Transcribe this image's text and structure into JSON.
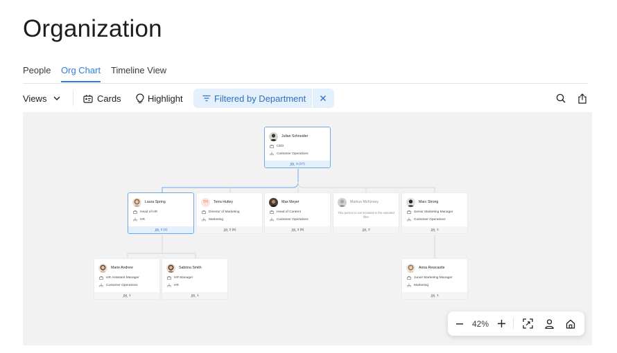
{
  "page": {
    "title": "Organization"
  },
  "tabs": [
    {
      "label": "People",
      "active": false
    },
    {
      "label": "Org Chart",
      "active": true
    },
    {
      "label": "Timeline View",
      "active": false
    }
  ],
  "toolbar": {
    "views_label": "Views",
    "cards_label": "Cards",
    "highlight_label": "Highlight",
    "filter_label": "Filtered by Department"
  },
  "nodes": {
    "julian": {
      "name": "Julian Schneider",
      "title": "CEO",
      "department": "Customer Operations",
      "reports": "5 (27)"
    },
    "laura": {
      "name": "Laura Spring",
      "title": "Head of HR",
      "department": "HR",
      "reports": "2 (4)"
    },
    "terra": {
      "name": "Terra Hutley",
      "initials": "TH",
      "title": "Director of Marketing",
      "department": "Marketing",
      "reports": "2 (6)"
    },
    "max": {
      "name": "Max Meyer",
      "title": "Head of Content",
      "department": "Customer Operations",
      "reports": "3 (9)"
    },
    "markus": {
      "name": "Markus McKinsey",
      "note": "This person is not included in the selected filter",
      "reports": "2"
    },
    "marc": {
      "name": "Marc Strong",
      "title": "Senior Marketing Manager",
      "department": "Customer Operations",
      "reports": "1"
    },
    "marie": {
      "name": "Marie Andrew",
      "title": "HR Assistant Manager",
      "department": "Customer Operations",
      "reports": "1"
    },
    "sabrina": {
      "name": "Sabrina Smith",
      "title": "HR Manager",
      "department": "HR",
      "reports": "1"
    },
    "anna": {
      "name": "Anna Rewcastle",
      "title": "Junior Marketing Manager",
      "department": "Marketing",
      "reports": "1"
    }
  },
  "zoom": {
    "level": "42%"
  },
  "colors": {
    "accent": "#2f7de1",
    "filter_bg": "#e4f0fc",
    "canvas_bg": "#f2f2f3"
  }
}
